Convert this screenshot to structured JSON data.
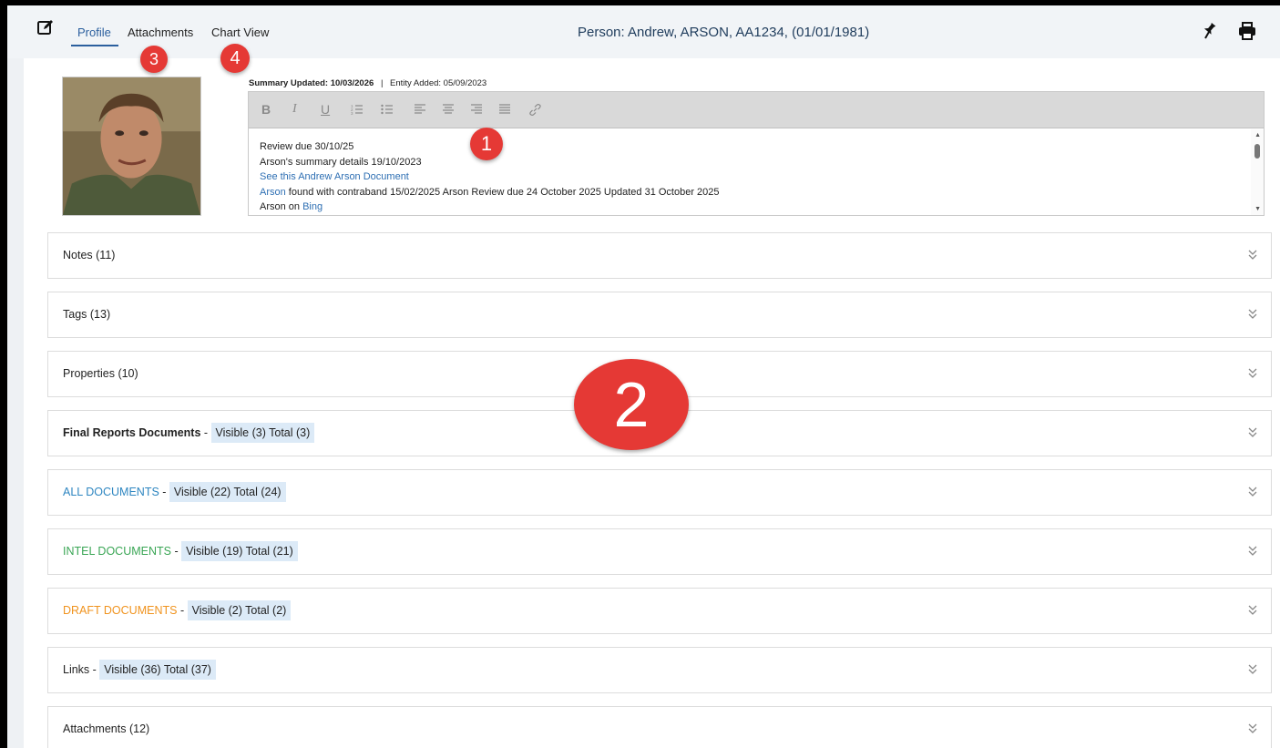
{
  "header": {
    "tabs": [
      {
        "label": "Profile",
        "active": true
      },
      {
        "label": "Attachments",
        "active": false
      },
      {
        "label": "Chart View",
        "active": false
      }
    ],
    "title": "Person: Andrew, ARSON, AA1234, (01/01/1981)",
    "icons": [
      "edit-icon",
      "pin-icon",
      "print-icon"
    ]
  },
  "summary": {
    "updated_label": "Summary Updated: 10/03/2026",
    "separator": "|",
    "added_label": "Entity Added: 05/09/2023",
    "toolbar": [
      "B",
      "I",
      "U",
      "ordered-list",
      "bullet-list",
      "align-left",
      "align-center",
      "align-right",
      "justify",
      "link"
    ],
    "lines": {
      "l1": "Review due 30/10/25",
      "l2": "Arson's summary details 19/10/2023",
      "l3_link": "See this Andrew Arson Document",
      "l4_link": "Arson",
      "l4_text": " found with contraband 15/02/2025 Arson Review due 24 October 2025 Updated 31 October 2025",
      "l5_text": "Arson on ",
      "l5_link": "Bing"
    }
  },
  "sections": {
    "notes": "Notes (11)",
    "tags": "Tags (13)",
    "properties": "Properties (10)",
    "final_title": "Final Reports Documents",
    "final_badge": "Visible (3) Total (3)",
    "all_title": "ALL DOCUMENTS",
    "all_badge": "Visible (22) Total (24)",
    "intel_title": "INTEL DOCUMENTS",
    "intel_badge": "Visible (19) Total (21)",
    "draft_title": "DRAFT DOCUMENTS",
    "draft_badge": "Visible (2) Total (2)",
    "links_title": "Links",
    "links_badge": "Visible (36) Total (37)",
    "attachments": "Attachments (12)",
    "dash": " - "
  },
  "markers": {
    "m1": "1",
    "m2": "2",
    "m3": "3",
    "m4": "4"
  },
  "colors": {
    "accent": "#2b5f9e",
    "all_documents": "#2e86c1",
    "intel_documents": "#3aa655",
    "draft_documents": "#f0931e",
    "badge_bg": "#dceaf7",
    "marker": "#e53935"
  }
}
